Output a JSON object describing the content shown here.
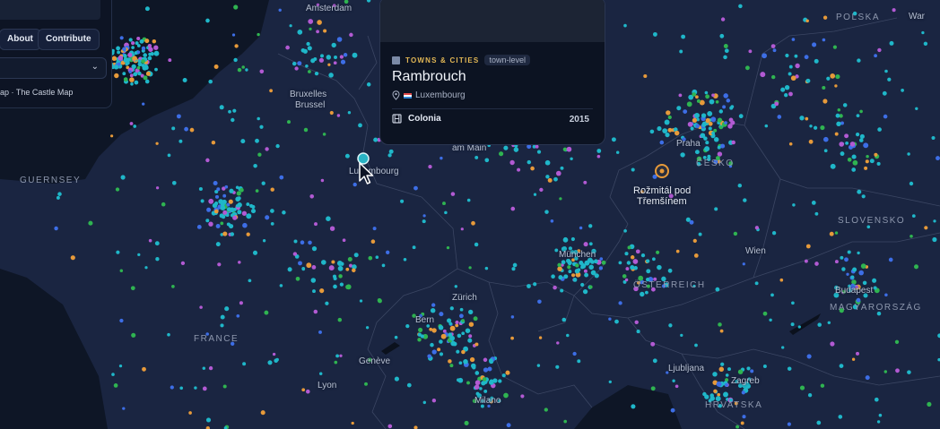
{
  "panel": {
    "about_label": "About",
    "contribute_label": "Contribute",
    "credit": "ap · The Castle Map"
  },
  "card": {
    "category": "TOWNS & CITIES",
    "tag": "town-level",
    "title": "Rambrouch",
    "country": "Luxembourg",
    "film": "Colonia",
    "year": "2015"
  },
  "map": {
    "cities": [
      "Amsterdam",
      "Bruxelles",
      "Brussel",
      "Luxembourg",
      "am Main",
      "Rožmitál pod",
      "Třemšínem",
      "München",
      "Zürich",
      "Bern",
      "Genève",
      "Lyon",
      "Milano",
      "Ljubljana",
      "Zagreb",
      "Budapest",
      "Wien",
      "Praha",
      "War"
    ],
    "regions": [
      "POLSKA",
      "ČESKO",
      "SLOVENSKO",
      "ÖSTERREICH",
      "MAGYARORSZÁG",
      "FRANCE",
      "GUERNSEY",
      "HRVATSKA"
    ]
  },
  "colors": {
    "ocean": "#0f1728",
    "land": "#1a2541",
    "marker_teal": "#1fb7c9",
    "marker_green": "#2fb451",
    "marker_purple": "#b25ad3",
    "marker_blue": "#3d6ee6",
    "marker_orange": "#e79a3a",
    "accent_gold": "#e2b755"
  }
}
